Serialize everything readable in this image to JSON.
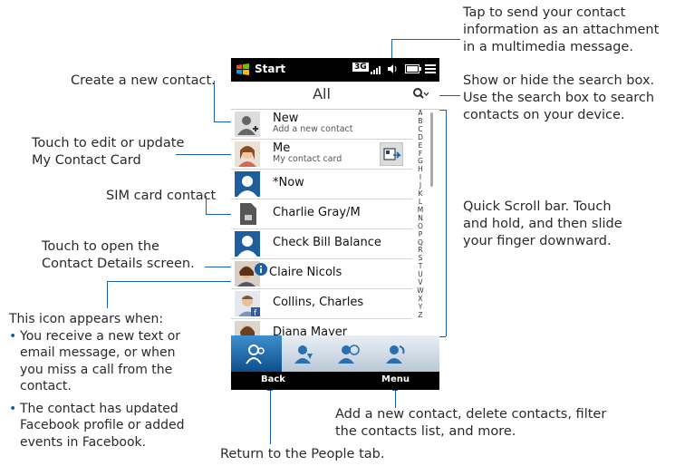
{
  "callouts": {
    "send_contact": [
      "Tap to send your contact",
      "information as an attachment",
      "in a multimedia message."
    ],
    "create_contact": "Create a new contact.",
    "edit_card": [
      "Touch to edit or update",
      "My Contact Card"
    ],
    "sim_contact": "SIM card contact",
    "contact_details": [
      "Touch to open the",
      "Contact Details screen."
    ],
    "icon_appears_title": "This icon appears when:",
    "icon_appears_bullets": [
      [
        "You receive a new text or",
        "email message, or when",
        "you miss a call from the",
        "contact."
      ],
      [
        "The contact has updated",
        "Facebook profile or added",
        "events in Facebook."
      ]
    ],
    "search_box": [
      "Show or hide the search box.",
      "Use the search box to search",
      "contacts on your device."
    ],
    "quick_scroll": [
      "Quick Scroll bar. Touch",
      "and hold, and then slide",
      "your finger downward."
    ],
    "menu": [
      "Add a new contact, delete contacts, filter",
      "the contacts list, and more."
    ],
    "back": "Return to the People tab."
  },
  "phone": {
    "start_label": "Start",
    "network_label": "3G",
    "header_title": "All",
    "contacts": [
      {
        "name": "New",
        "sub": "Add a new contact",
        "avatar": "add-contact"
      },
      {
        "name": "Me",
        "sub": "My contact card",
        "avatar": "photo-woman"
      },
      {
        "name": "*Now",
        "sub": "",
        "avatar": "silhouette"
      },
      {
        "name": "Charlie Gray/M",
        "sub": "",
        "avatar": "sim-card"
      },
      {
        "name": "Check Bill Balance",
        "sub": "",
        "avatar": "silhouette"
      },
      {
        "name": "Claire Nicols",
        "sub": "",
        "avatar": "photo-woman2"
      },
      {
        "name": "Collins, Charles",
        "sub": "",
        "avatar": "photo-man"
      },
      {
        "name": "Diana Mayer",
        "sub": "",
        "avatar": "photo-woman3"
      }
    ],
    "alphabet": [
      "A",
      "B",
      "C",
      "D",
      "E",
      "F",
      "G",
      "H",
      "I",
      "J",
      "K",
      "L",
      "M",
      "N",
      "O",
      "P",
      "Q",
      "R",
      "S",
      "T",
      "U",
      "V",
      "W",
      "X",
      "Y",
      "Z"
    ],
    "softkeys": {
      "left": "Back",
      "right": "Menu"
    }
  },
  "colors": {
    "accent": "#1b5fa8",
    "tab_active": "#2a7bc0"
  }
}
